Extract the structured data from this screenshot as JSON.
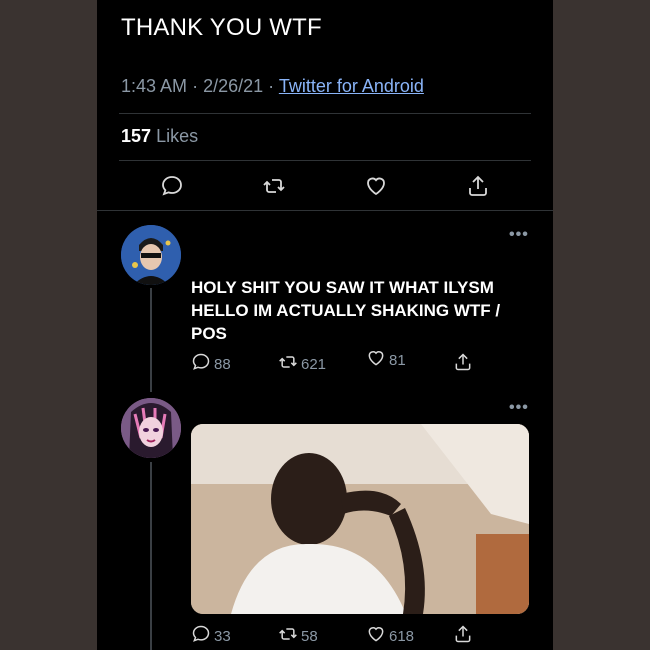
{
  "tweet": {
    "text": "THANK YOU WTF",
    "time": "1:43 AM",
    "date": "2/26/21",
    "source": "Twitter for Android",
    "likes_count": "157",
    "likes_label": "Likes"
  },
  "reply1": {
    "text": "HOLY SHIT YOU SAW IT WHAT ILYSM HELLO IM ACTUALLY SHAKING WTF / POS",
    "replies": "88",
    "retweets": "621",
    "likes": "81",
    "more": "•••"
  },
  "reply2": {
    "replies": "33",
    "retweets": "58",
    "likes": "618",
    "more": "•••"
  },
  "meta_sep": "·",
  "colors": {
    "background": "#000000",
    "secondary_text": "#8b98a5",
    "link": "#8ab4f8",
    "border": "#2f3336"
  }
}
